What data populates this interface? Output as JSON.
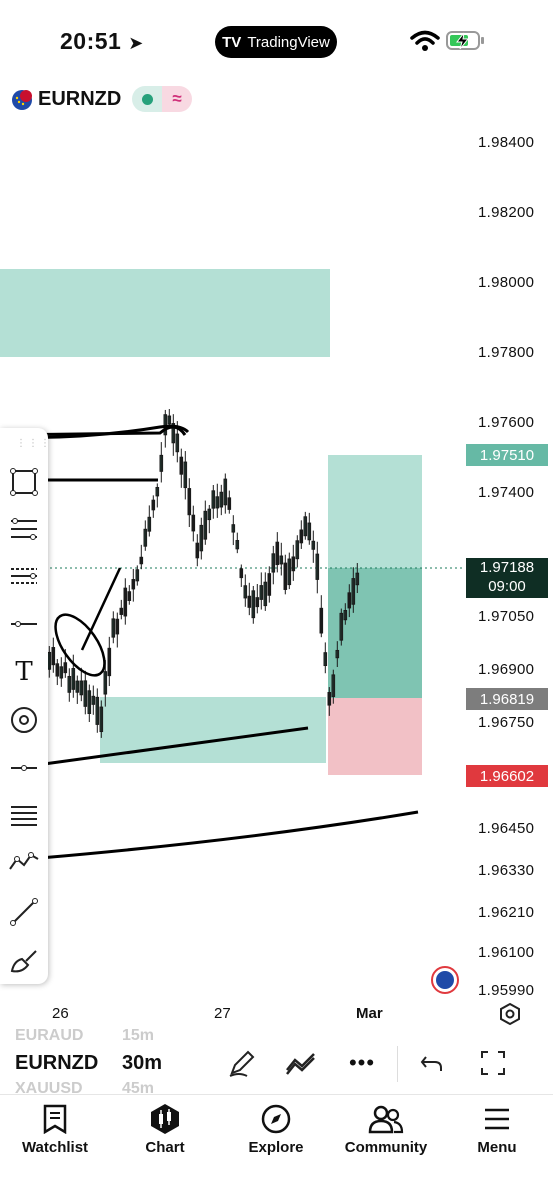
{
  "status_bar": {
    "time": "20:51",
    "app_pill": "TradingView"
  },
  "header": {
    "symbol": "EURNZD"
  },
  "price_axis": {
    "labels": [
      "1.98400",
      "1.98200",
      "1.98000",
      "1.97800",
      "1.97600",
      "1.97400",
      "1.97050",
      "1.96900",
      "1.96750",
      "1.96450",
      "1.96330",
      "1.96210",
      "1.96100",
      "1.95990"
    ],
    "tag_take_profit": "1.97510",
    "tag_current_price": "1.97188",
    "tag_countdown": "09:00",
    "tag_entry": "1.96819",
    "tag_stop_loss": "1.96602",
    "colors": {
      "tp": "#66b9a5",
      "current": "#0f2e24",
      "entry": "#7d7d7d",
      "sl": "#e0393e"
    }
  },
  "time_axis": {
    "labels": [
      "26",
      "27",
      "Mar"
    ]
  },
  "bottom_toolbar": {
    "symbol_above": "EURAUD",
    "interval_above": "15m",
    "symbol": "EURNZD",
    "interval": "30m",
    "symbol_below": "XAUUSD",
    "interval_below": "45m",
    "icons": [
      "pen-icon",
      "indicators-icon",
      "more-icon",
      "undo-icon",
      "fullscreen-icon"
    ]
  },
  "nav": {
    "items": [
      {
        "label": "Watchlist",
        "icon": "watchlist-icon"
      },
      {
        "label": "Chart",
        "icon": "chart-icon"
      },
      {
        "label": "Explore",
        "icon": "compass-icon"
      },
      {
        "label": "Community",
        "icon": "community-icon"
      },
      {
        "label": "Menu",
        "icon": "menu-icon"
      }
    ]
  },
  "drawing_tools": [
    "rectangle-tool-icon",
    "fib-tool-icon",
    "position-tool-icon",
    "horizontal-line-icon",
    "text-tool-icon",
    "circle-tool-icon",
    "ray-tool-icon",
    "parallel-channel-icon",
    "pattern-tool-icon",
    "trendline-icon",
    "brush-tool-icon"
  ]
}
